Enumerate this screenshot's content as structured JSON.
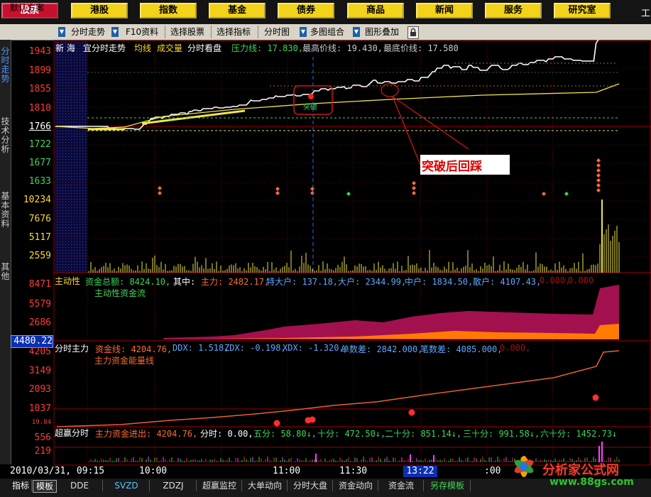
{
  "nav": {
    "items": [
      {
        "label": "股票",
        "active": true
      },
      {
        "label": "港股"
      },
      {
        "label": "指数"
      },
      {
        "label": "基金"
      },
      {
        "label": "债券"
      },
      {
        "label": "商品"
      },
      {
        "label": "新闻"
      },
      {
        "label": "服务"
      },
      {
        "label": "研究室"
      }
    ],
    "cut_label": "工"
  },
  "toolbar": {
    "scheme": "默认方案",
    "items": [
      "分时走势",
      "F10资料",
      "选择股票",
      "选择指标",
      "分时图",
      "多图组合",
      "图形叠加"
    ]
  },
  "left_tabs": [
    {
      "label": "分时走势",
      "active": true
    },
    {
      "label": "技术分析"
    },
    {
      "label": "基本资料"
    },
    {
      "label": "其他"
    }
  ],
  "header": {
    "stock": "新 海",
    "mode": "宜分时走势",
    "ma_label": "均线",
    "vol_label": "成交量",
    "view": "分时看盘",
    "pressure": "压力线: 17.830,",
    "high": "最高价线: 19.430,",
    "low": "最底价线: 17.580"
  },
  "price_axis": [
    "1943",
    "1899",
    "1855",
    "1810",
    "1766",
    "1722",
    "1677",
    "1633"
  ],
  "volume_axis": [
    "10234",
    "7676",
    "5117",
    "2559"
  ],
  "annotations": {
    "breakout": "突破",
    "callout": "突破后回踩"
  },
  "active_panel": {
    "title": "主动性",
    "total": "资金总额: 8424.10,",
    "among": "其中:",
    "main": "主力: 2482.17,",
    "special": "特大户: 137.18,",
    "large": "大户: 2344.99,",
    "medium": "中户: 1834.50,",
    "retail": "散户: 4107.43,",
    "z1": "0.000,",
    "z2": "0.000",
    "sub": "主动性资金流",
    "axis": [
      "8471",
      "5579",
      "2686"
    ]
  },
  "cursor_value": "4480.22",
  "main_panel": {
    "title": "分时主力",
    "line": "资金线: 4204.76,",
    "ddx": "DDX: 1.518,",
    "zdx": "ZDX: -0.198,",
    "xdx": "XDX: -1.320,",
    "single": "单数差: 2842.000,",
    "order": "笔数差: 4085.000,",
    "z": "0.000,",
    "sub": "主力资金能量线",
    "axis": [
      "4205",
      "3149",
      "2093",
      "1037",
      "19.84"
    ]
  },
  "flow_panel": {
    "title": "超赢分时",
    "label": "主力资金进出: 4204.76,",
    "m1": "分时: 0.00,",
    "m5": "五分: 58.80↓,",
    "m10": "十分: 472.50↓,",
    "m20": "二十分: 851.14↓,",
    "m30": "三十分: 991.58↓,",
    "m60": "六十分: 1452.73↓",
    "axis": [
      "556",
      "219"
    ]
  },
  "time_axis": {
    "date": "2010/03/31, 09:15",
    "t1": "10:00",
    "t2": "11:00",
    "t3": "11:30",
    "cursor": "13:22",
    "t4": ":00"
  },
  "bottom_tabs": [
    "指标",
    "模板",
    "DDE",
    "SVZD",
    "ZDZJ",
    "超赢监控",
    "大单动向",
    "分时大盘",
    "资金动向",
    "资金流",
    "另存模板"
  ],
  "watermark": {
    "name": "分析家公式网",
    "url": "www.88gs.com"
  },
  "colors": {
    "nav": "#f2d21a",
    "navActive": "#c8102e",
    "price": "#ffffff",
    "avg": "#f0e54a",
    "flowArea": "#a3104e",
    "flowArea2": "#ff7a00",
    "mainLine": "#e8612c",
    "dots": "#ff2e2e"
  }
}
